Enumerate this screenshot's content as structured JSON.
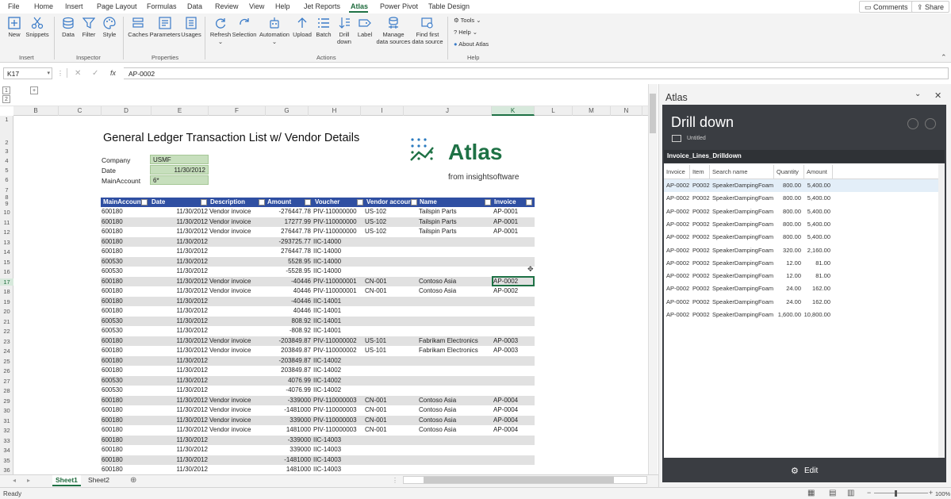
{
  "menu": {
    "items": [
      "File",
      "Home",
      "Insert",
      "Page Layout",
      "Formulas",
      "Data",
      "Review",
      "View",
      "Help",
      "Jet Reports",
      "Atlas",
      "Power Pivot",
      "Table Design"
    ],
    "active": "Atlas",
    "comments": "Comments",
    "share": "Share"
  },
  "ribbon": {
    "new": "New",
    "snippets": "Snippets",
    "insert_group": "Insert",
    "data": "Data",
    "filter": "Filter",
    "style": "Style",
    "inspector_group": "Inspector",
    "caches": "Caches",
    "parameters": "Parameters",
    "usages": "Usages",
    "properties_group": "Properties",
    "refresh": "Refresh",
    "selection": "Selection",
    "automation": "Automation",
    "upload": "Upload",
    "batch": "Batch",
    "drill": "Drill",
    "down": "down",
    "label": "Label",
    "manage1": "Manage",
    "manage2": "data sources",
    "find1": "Find first",
    "find2": "data source",
    "actions_group": "Actions",
    "tools": "Tools",
    "help": "Help",
    "about": "About Atlas",
    "help_group": "Help"
  },
  "formula_bar": {
    "name_box": "K17",
    "fx": "fx",
    "value": "AP-0002"
  },
  "columns": [
    "B",
    "C",
    "D",
    "E",
    "F",
    "G",
    "H",
    "I",
    "J",
    "K",
    "L",
    "M",
    "N"
  ],
  "selected_column": "K",
  "rows": [
    "1",
    "2",
    "3",
    "4",
    "5",
    "6",
    "7",
    "8",
    "9",
    "10",
    "11",
    "12",
    "13",
    "14",
    "15",
    "16",
    "17",
    "18",
    "19",
    "20",
    "21",
    "22",
    "23",
    "24",
    "25",
    "26",
    "27",
    "28",
    "29",
    "30",
    "31",
    "32",
    "33",
    "34",
    "35",
    "36"
  ],
  "selected_row": "17",
  "sheet": {
    "title": "General Ledger Transaction List w/ Vendor Details",
    "params": [
      {
        "label": "Company",
        "value": "USMF"
      },
      {
        "label": "Date",
        "value": "11/30/2012"
      },
      {
        "label": "MainAccount",
        "value": "6*"
      }
    ],
    "logo_text": "Atlas",
    "logo_sub": "from insightsoftware",
    "headers": [
      "MainAccount",
      "Date",
      "Description",
      "Amount",
      "Voucher",
      "Vendor accour",
      "Name",
      "Invoice"
    ],
    "rows": [
      [
        "600180",
        "11/30/2012",
        "Vendor invoice",
        "-276447.78",
        "PIV-110000000",
        "US-102",
        "Tailspin Parts",
        "AP-0001"
      ],
      [
        "600180",
        "11/30/2012",
        "Vendor invoice",
        "17277.99",
        "PIV-110000000",
        "US-102",
        "Tailspin Parts",
        "AP-0001"
      ],
      [
        "600180",
        "11/30/2012",
        "Vendor invoice",
        "276447.78",
        "PIV-110000000",
        "US-102",
        "Tailspin Parts",
        "AP-0001"
      ],
      [
        "600180",
        "11/30/2012",
        "",
        "-293725.77",
        "IIC-14000",
        "",
        "",
        ""
      ],
      [
        "600180",
        "11/30/2012",
        "",
        "276447.78",
        "IIC-14000",
        "",
        "",
        ""
      ],
      [
        "600530",
        "11/30/2012",
        "",
        "5528.95",
        "IIC-14000",
        "",
        "",
        ""
      ],
      [
        "600530",
        "11/30/2012",
        "",
        "-5528.95",
        "IIC-14000",
        "",
        "",
        ""
      ],
      [
        "600180",
        "11/30/2012",
        "Vendor invoice",
        "-40446",
        "PIV-110000001",
        "CN-001",
        "Contoso Asia",
        "AP-0002"
      ],
      [
        "600180",
        "11/30/2012",
        "Vendor invoice",
        "40446",
        "PIV-110000001",
        "CN-001",
        "Contoso Asia",
        "AP-0002"
      ],
      [
        "600180",
        "11/30/2012",
        "",
        "-40446",
        "IIC-14001",
        "",
        "",
        ""
      ],
      [
        "600180",
        "11/30/2012",
        "",
        "40446",
        "IIC-14001",
        "",
        "",
        ""
      ],
      [
        "600530",
        "11/30/2012",
        "",
        "808.92",
        "IIC-14001",
        "",
        "",
        ""
      ],
      [
        "600530",
        "11/30/2012",
        "",
        "-808.92",
        "IIC-14001",
        "",
        "",
        ""
      ],
      [
        "600180",
        "11/30/2012",
        "Vendor invoice",
        "-203849.87",
        "PIV-110000002",
        "US-101",
        "Fabrikam Electronics",
        "AP-0003"
      ],
      [
        "600180",
        "11/30/2012",
        "Vendor invoice",
        "203849.87",
        "PIV-110000002",
        "US-101",
        "Fabrikam Electronics",
        "AP-0003"
      ],
      [
        "600180",
        "11/30/2012",
        "",
        "-203849.87",
        "IIC-14002",
        "",
        "",
        ""
      ],
      [
        "600180",
        "11/30/2012",
        "",
        "203849.87",
        "IIC-14002",
        "",
        "",
        ""
      ],
      [
        "600530",
        "11/30/2012",
        "",
        "4076.99",
        "IIC-14002",
        "",
        "",
        ""
      ],
      [
        "600530",
        "11/30/2012",
        "",
        "-4076.99",
        "IIC-14002",
        "",
        "",
        ""
      ],
      [
        "600180",
        "11/30/2012",
        "Vendor invoice",
        "-339000",
        "PIV-110000003",
        "CN-001",
        "Contoso Asia",
        "AP-0004"
      ],
      [
        "600180",
        "11/30/2012",
        "Vendor invoice",
        "-1481000",
        "PIV-110000003",
        "CN-001",
        "Contoso Asia",
        "AP-0004"
      ],
      [
        "600180",
        "11/30/2012",
        "Vendor invoice",
        "339000",
        "PIV-110000003",
        "CN-001",
        "Contoso Asia",
        "AP-0004"
      ],
      [
        "600180",
        "11/30/2012",
        "Vendor invoice",
        "1481000",
        "PIV-110000003",
        "CN-001",
        "Contoso Asia",
        "AP-0004"
      ],
      [
        "600180",
        "11/30/2012",
        "",
        "-339000",
        "IIC-14003",
        "",
        "",
        ""
      ],
      [
        "600180",
        "11/30/2012",
        "",
        "339000",
        "IIC-14003",
        "",
        "",
        ""
      ],
      [
        "600180",
        "11/30/2012",
        "",
        "-1481000",
        "IIC-14003",
        "",
        "",
        ""
      ],
      [
        "600180",
        "11/30/2012",
        "",
        "1481000",
        "IIC-14003",
        "",
        "",
        ""
      ]
    ]
  },
  "tabs": {
    "sheet1": "Sheet1",
    "sheet2": "Sheet2"
  },
  "status": {
    "ready": "Ready",
    "zoom": "100%"
  },
  "pane": {
    "title": "Atlas",
    "heading": "Drill down",
    "subtitle": "Untitled",
    "table_title": "Invoice_Lines_Drilldown",
    "columns": [
      "Invoice",
      "Item",
      "Search name",
      "Quantity",
      "Amount"
    ],
    "rows": [
      [
        "AP-0002",
        "P0002",
        "SpeakerDampingFoam",
        "800.00",
        "5,400.00"
      ],
      [
        "AP-0002",
        "P0002",
        "SpeakerDampingFoam",
        "800.00",
        "5,400.00"
      ],
      [
        "AP-0002",
        "P0002",
        "SpeakerDampingFoam",
        "800.00",
        "5,400.00"
      ],
      [
        "AP-0002",
        "P0002",
        "SpeakerDampingFoam",
        "800.00",
        "5,400.00"
      ],
      [
        "AP-0002",
        "P0002",
        "SpeakerDampingFoam",
        "800.00",
        "5,400.00"
      ],
      [
        "AP-0002",
        "P0002",
        "SpeakerDampingFoam",
        "320.00",
        "2,160.00"
      ],
      [
        "AP-0002",
        "P0002",
        "SpeakerDampingFoam",
        "12.00",
        "81.00"
      ],
      [
        "AP-0002",
        "P0002",
        "SpeakerDampingFoam",
        "12.00",
        "81.00"
      ],
      [
        "AP-0002",
        "P0002",
        "SpeakerDampingFoam",
        "24.00",
        "162.00"
      ],
      [
        "AP-0002",
        "P0002",
        "SpeakerDampingFoam",
        "24.00",
        "162.00"
      ],
      [
        "AP-0002",
        "P0002",
        "SpeakerDampingFoam",
        "1,600.00",
        "10,800.00"
      ]
    ],
    "edit": "Edit"
  }
}
